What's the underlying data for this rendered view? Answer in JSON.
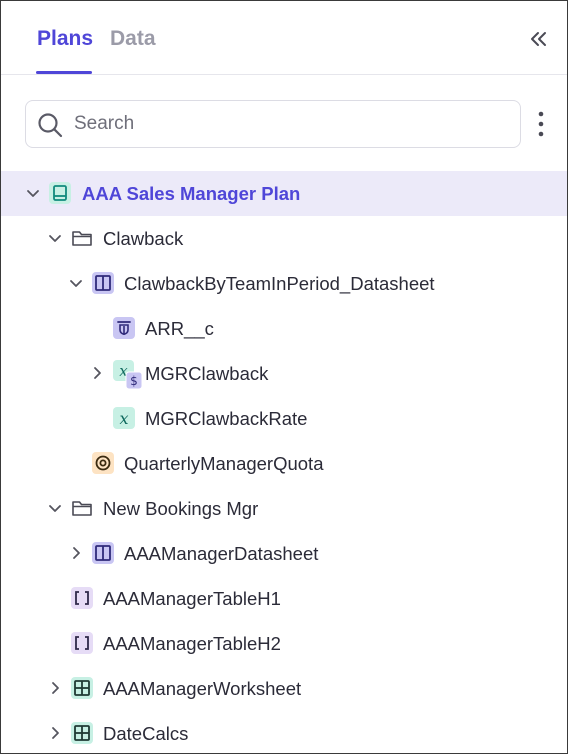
{
  "tabs": [
    {
      "label": "Plans",
      "active": true
    },
    {
      "label": "Data",
      "active": false
    }
  ],
  "search": {
    "placeholder": "Search",
    "value": ""
  },
  "colors": {
    "accent": "#4f46d8",
    "selected_row_bg": "#eceaf9",
    "book_icon": "#0f9a8a",
    "datasheet_icon_bg": "#c9c6f3",
    "formula_icon_bg": "#c7f0e4",
    "target_icon_bg": "#fde3c3",
    "table_icon_bg": "#e6dcf6"
  },
  "tree": [
    {
      "label": "AAA Sales Manager Plan",
      "icon": "book-icon",
      "expanded": true,
      "selected": true
    },
    {
      "label": "Clawback",
      "icon": "folder-icon",
      "expanded": true
    },
    {
      "label": "ClawbackByTeamInPeriod_Datasheet",
      "icon": "datasheet-icon",
      "expanded": true
    },
    {
      "label": "ARR__c",
      "icon": "field-icon"
    },
    {
      "label": "MGRClawback",
      "icon": "formula-currency-icon",
      "expanded": false
    },
    {
      "label": "MGRClawbackRate",
      "icon": "formula-icon"
    },
    {
      "label": "QuarterlyManagerQuota",
      "icon": "target-icon"
    },
    {
      "label": "New Bookings Mgr",
      "icon": "folder-icon",
      "expanded": true
    },
    {
      "label": "AAAManagerDatasheet",
      "icon": "datasheet-icon",
      "expanded": false
    },
    {
      "label": "AAAManagerTableH1",
      "icon": "bracket-table-icon"
    },
    {
      "label": "AAAManagerTableH2",
      "icon": "bracket-table-icon"
    },
    {
      "label": "AAAManagerWorksheet",
      "icon": "worksheet-icon",
      "expanded": false
    },
    {
      "label": "DateCalcs",
      "icon": "worksheet-icon",
      "expanded": false
    }
  ]
}
